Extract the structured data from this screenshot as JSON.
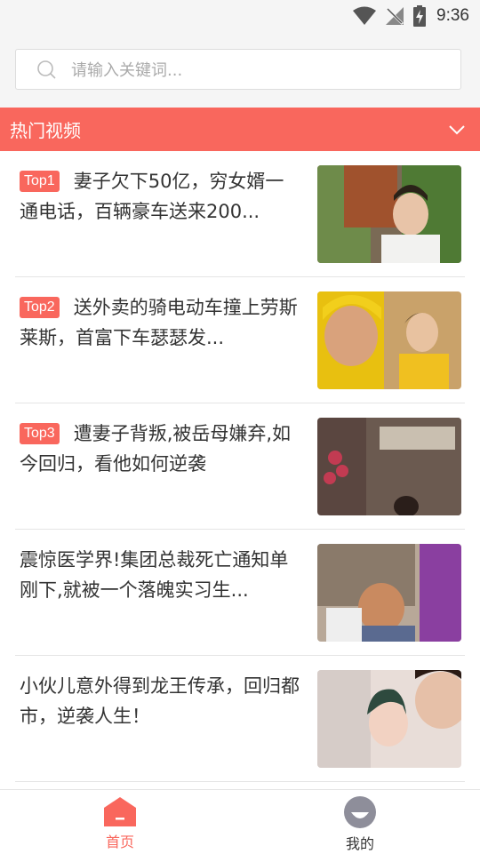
{
  "status": {
    "time": "9:36"
  },
  "search": {
    "placeholder": "请输入关键词..."
  },
  "section": {
    "title": "热门视频"
  },
  "videos": [
    {
      "badge": "Top1",
      "title": "妻子欠下50亿，穷女婿一通电话，百辆豪车送来200..."
    },
    {
      "badge": "Top2",
      "title": "送外卖的骑电动车撞上劳斯莱斯，首富下车瑟瑟发..."
    },
    {
      "badge": "Top3",
      "title": "遭妻子背叛,被岳母嫌弃,如今回归，看他如何逆袭"
    },
    {
      "badge": "",
      "title": "震惊医学界!集团总裁死亡通知单刚下,就被一个落魄实习生..."
    },
    {
      "badge": "",
      "title": "小伙儿意外得到龙王传承，回归都市，逆袭人生！"
    }
  ],
  "tabbar": {
    "home_label": "首页",
    "mine_label": "我的"
  },
  "colors": {
    "accent": "#f9675d",
    "background": "#f5f5f5",
    "text": "#333333"
  },
  "icons": {
    "wifi": "wifi-icon",
    "signal": "no-signal-icon",
    "battery": "battery-charging-icon",
    "search": "search-icon",
    "chevron": "chevron-down-icon",
    "home": "home-icon",
    "profile": "profile-icon"
  }
}
